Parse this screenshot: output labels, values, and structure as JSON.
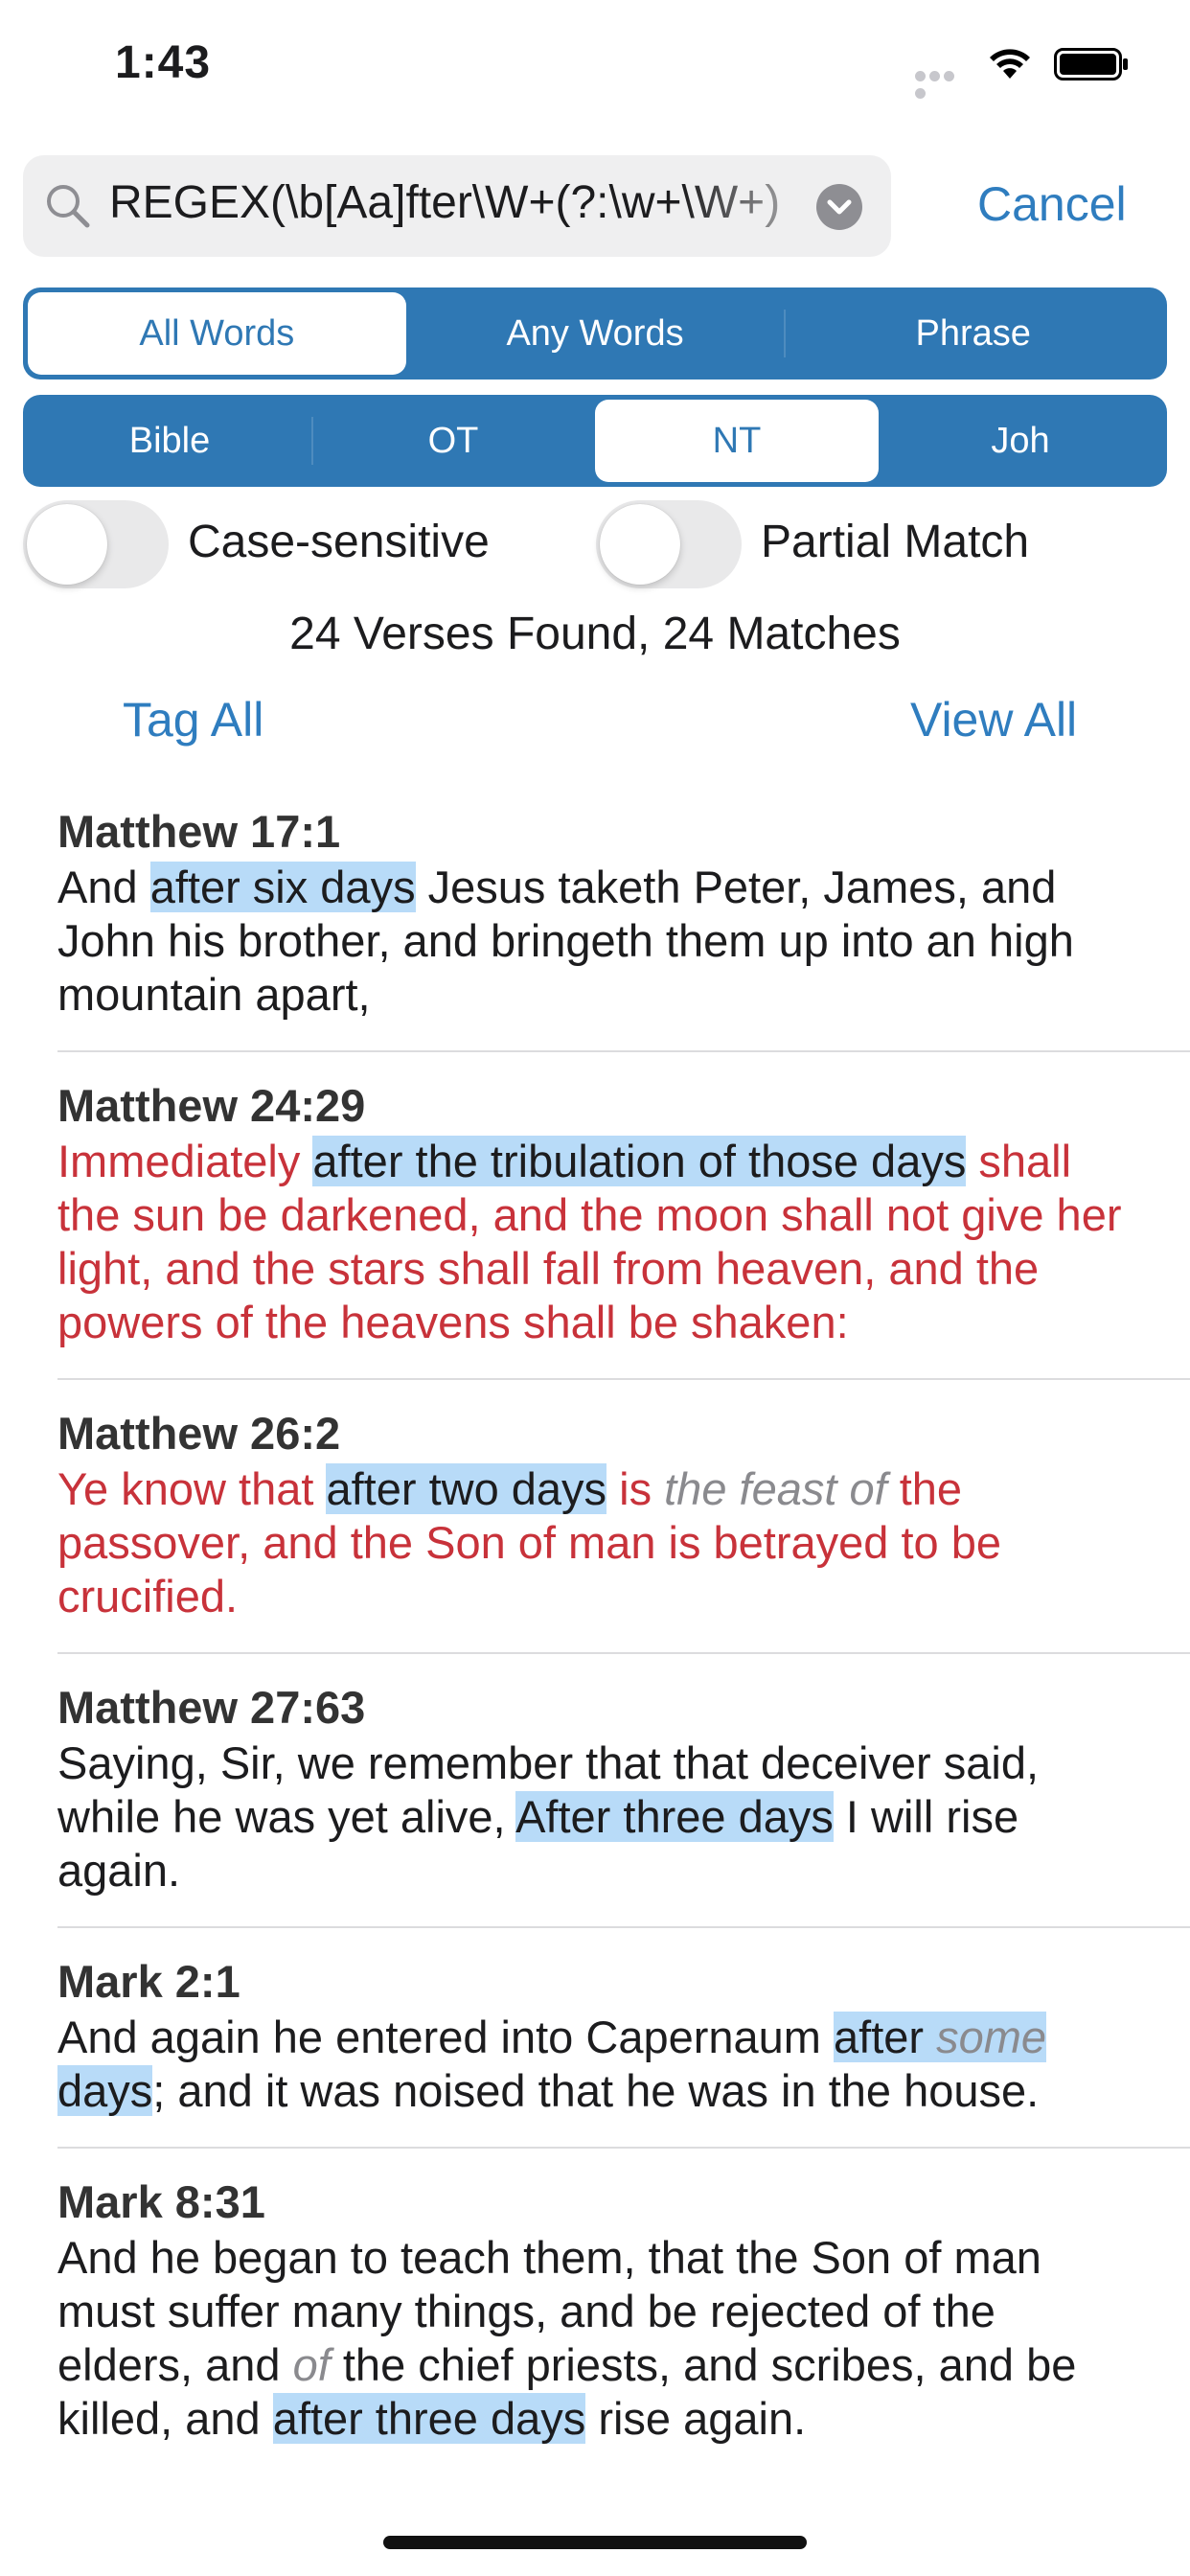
{
  "status_bar": {
    "time": "1:43"
  },
  "search": {
    "query": "REGEX(\\b[Aa]fter\\W+(?:\\w+\\W+)",
    "cancel_label": "Cancel"
  },
  "match_mode": {
    "options": [
      "All Words",
      "Any Words",
      "Phrase"
    ],
    "selected": "All Words"
  },
  "scope": {
    "options": [
      "Bible",
      "OT",
      "NT",
      "Joh"
    ],
    "selected": "NT"
  },
  "options": {
    "case_sensitive_label": "Case-sensitive",
    "case_sensitive_on": false,
    "partial_match_label": "Partial Match",
    "partial_match_on": false
  },
  "results_summary": "24 Verses Found, 24 Matches",
  "actions": {
    "tag_all": "Tag All",
    "view_all": "View All"
  },
  "colors": {
    "accent": "#2f78b4",
    "link": "#2f7dbf",
    "highlight": "#b8dbf8",
    "words_of_christ": "#c8323a",
    "italic_supplied": "#8a8a8e"
  },
  "verses": [
    {
      "ref": "Matthew 17:1",
      "red": false,
      "segments": [
        {
          "t": "And "
        },
        {
          "t": "after six days",
          "hl": true
        },
        {
          "t": " Jesus taketh Peter, James, and John his brother, and bringeth them up into an high mountain apart,"
        }
      ]
    },
    {
      "ref": "Matthew 24:29",
      "red": true,
      "segments": [
        {
          "t": "Immediately "
        },
        {
          "t": "after the tribulation of those days",
          "hl": true
        },
        {
          "t": " shall the sun be darkened, and the moon shall not give her light, and the stars shall fall from heaven, and the powers of the heavens shall be shaken:"
        }
      ]
    },
    {
      "ref": "Matthew 26:2",
      "red": true,
      "segments": [
        {
          "t": "Ye know that "
        },
        {
          "t": "after two days",
          "hl": true
        },
        {
          "t": " is "
        },
        {
          "t": "the feast of",
          "it": true
        },
        {
          "t": " the passover, and the Son of man is betrayed to be crucified."
        }
      ]
    },
    {
      "ref": "Matthew 27:63",
      "red": false,
      "segments": [
        {
          "t": "Saying, Sir, we remember that that deceiver said, while he was yet alive, "
        },
        {
          "t": "After three days",
          "hl": true
        },
        {
          "t": " I will rise again."
        }
      ]
    },
    {
      "ref": "Mark 2:1",
      "red": false,
      "segments": [
        {
          "t": "And again he entered into Capernaum "
        },
        {
          "t": "after ",
          "hl": true
        },
        {
          "t": "some ",
          "hl": true,
          "it": true
        },
        {
          "t": "days",
          "hl": true
        },
        {
          "t": "; and it was noised that he was in the house."
        }
      ]
    },
    {
      "ref": "Mark 8:31",
      "red": false,
      "segments": [
        {
          "t": "And he began to teach them, that the Son of man must suffer many things, and be rejected of the elders, and "
        },
        {
          "t": "of",
          "it": true
        },
        {
          "t": " the chief priests, and scribes, and be killed, and "
        },
        {
          "t": "after three days",
          "hl": true
        },
        {
          "t": " rise again."
        }
      ]
    }
  ]
}
